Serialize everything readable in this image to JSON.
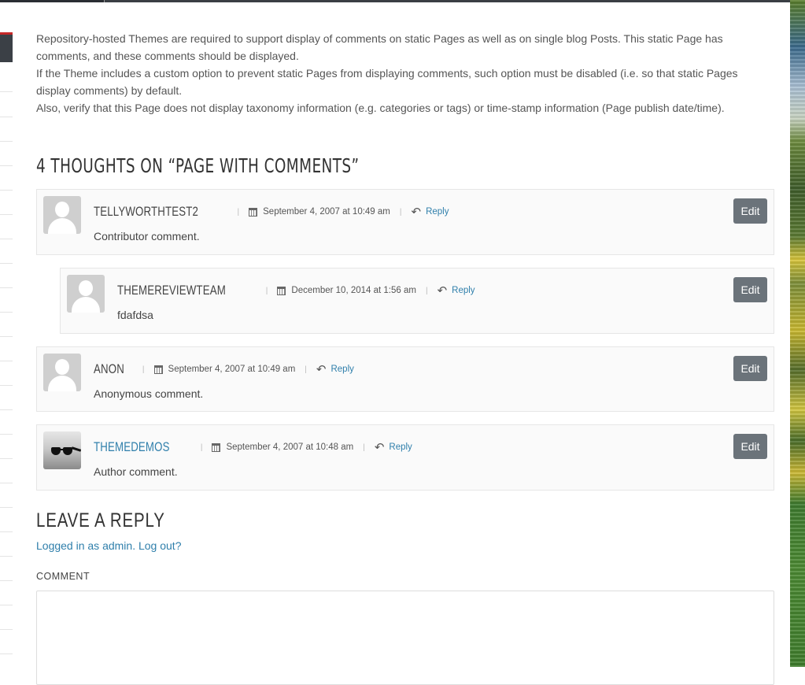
{
  "intro": {
    "paragraph1": "Repository-hosted Themes are required to support display of comments on static Pages as well as on single blog Posts. This static Page has comments, and these comments should be displayed.",
    "paragraph2": "If the Theme includes a custom option to prevent static Pages from displaying comments, such option must be disabled (i.e. so that static Pages display comments) by default.",
    "paragraph3": "Also, verify that this Page does not display taxonomy information (e.g. categories or tags) or time-stamp information (Page publish date/time)."
  },
  "comments_title": "4 THOUGHTS ON “PAGE WITH COMMENTS”",
  "comments": [
    {
      "author": "TELLYWORTHTEST2",
      "date": "September 4, 2007 at 10:49 am",
      "reply": "Reply",
      "text": "Contributor comment.",
      "edit": "Edit",
      "avatar": "default-avatar-icon"
    },
    {
      "author": "THEMEREVIEWTEAM",
      "date": "December 10, 2014 at 1:56 am",
      "reply": "Reply",
      "text": "fdafdsa",
      "edit": "Edit",
      "avatar": "default-avatar-icon"
    },
    {
      "author": "ANON",
      "date": "September 4, 2007 at 10:49 am",
      "reply": "Reply",
      "text": "Anonymous comment.",
      "edit": "Edit",
      "avatar": "default-avatar-icon"
    },
    {
      "author": "THEMEDEMOS",
      "date": "September 4, 2007 at 10:48 am",
      "reply": "Reply",
      "text": "Author comment.",
      "edit": "Edit",
      "avatar": "sunglasses-photo-avatar"
    }
  ],
  "reply_form": {
    "title": "LEAVE A REPLY",
    "logged_in_text": "Logged in as admin.",
    "logout_text": "Log out?",
    "comment_label": "COMMENT"
  },
  "colors": {
    "link": "#2f7fab",
    "edit_button": "#6b737a",
    "sidebar_accent": "#c62828"
  }
}
